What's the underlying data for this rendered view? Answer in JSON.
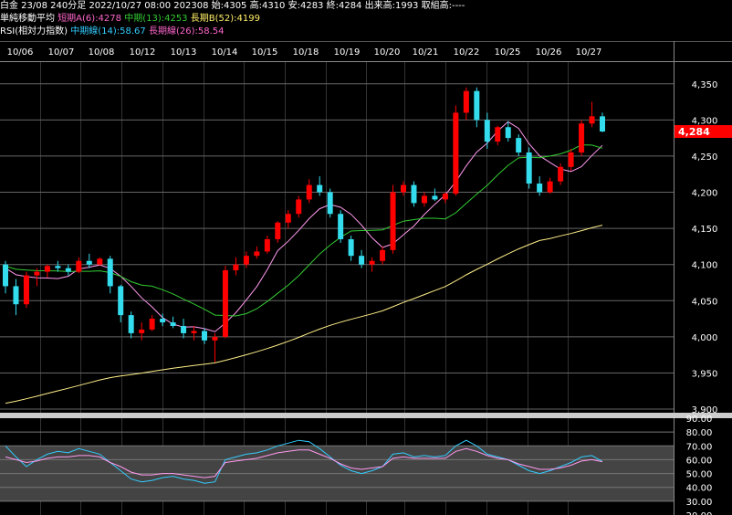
{
  "header": {
    "line1": "白金 23/08 240分足 2022/10/27 08:00 202308 始:4305 高:4310 安:4283 終:4284 出来高:1993 取組高:----",
    "ma_label": "単純移動平均",
    "ma_a": "短期A(6):4278",
    "ma_b": "中期(13):4253",
    "ma_c": "長期B(52):4199",
    "rsi_label": "RSI(相対力指数)",
    "rsi_mid": "中期線(14):58.67",
    "rsi_long": "長期線(26):58.54"
  },
  "colors": {
    "up": "#ff0000",
    "down": "#33ddee",
    "ma_short": "#ff99ee",
    "ma_mid": "#33cc33",
    "ma_long": "#ffee88",
    "rsi_mid": "#33ccff",
    "rsi_long": "#ff99ee",
    "badge": "#ff0000",
    "rsi_band": "#444444"
  },
  "chart_data": [
    {
      "type": "candlestick",
      "x_dates": [
        "10/06",
        "10/07",
        "10/08",
        "10/12",
        "10/13",
        "10/14",
        "10/15",
        "10/18",
        "10/19",
        "10/20",
        "10/21",
        "10/22",
        "10/25",
        "10/26",
        "10/27"
      ],
      "y_ticks": [
        4350,
        4300,
        4250,
        4200,
        4150,
        4100,
        4050,
        4000,
        3950,
        3900
      ],
      "y_tick_labels": [
        "4,350",
        "4,300",
        "4,250",
        "4,200",
        "4,150",
        "4,100",
        "4,050",
        "4,000",
        "3,950",
        "3,900"
      ],
      "ylim": [
        3895,
        4380
      ],
      "last_price": 4284,
      "last_price_label": "4,284",
      "candles": [
        [
          4100,
          4105,
          4060,
          4070
        ],
        [
          4070,
          4080,
          4030,
          4045
        ],
        [
          4045,
          4090,
          4040,
          4085
        ],
        [
          4085,
          4095,
          4070,
          4090
        ],
        [
          4090,
          4100,
          4082,
          4098
        ],
        [
          4098,
          4105,
          4090,
          4095
        ],
        [
          4095,
          4100,
          4085,
          4090
        ],
        [
          4090,
          4110,
          4088,
          4105
        ],
        [
          4105,
          4115,
          4095,
          4100
        ],
        [
          4100,
          4110,
          4098,
          4108
        ],
        [
          4108,
          4112,
          4060,
          4070
        ],
        [
          4070,
          4072,
          4020,
          4030
        ],
        [
          4030,
          4035,
          3998,
          4005
        ],
        [
          4005,
          4020,
          3995,
          4010
        ],
        [
          4010,
          4030,
          4008,
          4025
        ],
        [
          4025,
          4032,
          4015,
          4020
        ],
        [
          4020,
          4028,
          4012,
          4015
        ],
        [
          4015,
          4025,
          3998,
          4005
        ],
        [
          4005,
          4015,
          3995,
          4008
        ],
        [
          4008,
          4012,
          3990,
          3995
        ],
        [
          3995,
          4005,
          3965,
          4000
        ],
        [
          4000,
          4098,
          3998,
          4092
        ],
        [
          4092,
          4110,
          4085,
          4100
        ],
        [
          4100,
          4118,
          4095,
          4112
        ],
        [
          4112,
          4125,
          4108,
          4118
        ],
        [
          4118,
          4140,
          4115,
          4135
        ],
        [
          4135,
          4160,
          4130,
          4158
        ],
        [
          4158,
          4175,
          4150,
          4170
        ],
        [
          4170,
          4195,
          4165,
          4190
        ],
        [
          4190,
          4218,
          4185,
          4210
        ],
        [
          4210,
          4222,
          4195,
          4200
        ],
        [
          4200,
          4205,
          4165,
          4170
        ],
        [
          4170,
          4175,
          4130,
          4135
        ],
        [
          4135,
          4140,
          4105,
          4112
        ],
        [
          4112,
          4120,
          4095,
          4100
        ],
        [
          4100,
          4110,
          4090,
          4105
        ],
        [
          4105,
          4125,
          4100,
          4120
        ],
        [
          4120,
          4210,
          4115,
          4200
        ],
        [
          4200,
          4215,
          4195,
          4210
        ],
        [
          4210,
          4215,
          4180,
          4185
        ],
        [
          4185,
          4200,
          4180,
          4195
        ],
        [
          4195,
          4205,
          4188,
          4190
        ],
        [
          4190,
          4200,
          4185,
          4198
        ],
        [
          4198,
          4320,
          4195,
          4310
        ],
        [
          4310,
          4345,
          4300,
          4340
        ],
        [
          4340,
          4345,
          4290,
          4300
        ],
        [
          4300,
          4310,
          4260,
          4270
        ],
        [
          4270,
          4292,
          4265,
          4290
        ],
        [
          4290,
          4298,
          4270,
          4275
        ],
        [
          4275,
          4280,
          4250,
          4255
        ],
        [
          4255,
          4262,
          4205,
          4212
        ],
        [
          4212,
          4222,
          4195,
          4200
        ],
        [
          4200,
          4220,
          4198,
          4215
        ],
        [
          4215,
          4240,
          4210,
          4235
        ],
        [
          4235,
          4260,
          4230,
          4255
        ],
        [
          4255,
          4300,
          4250,
          4295
        ],
        [
          4295,
          4325,
          4290,
          4305
        ],
        [
          4305,
          4310,
          4283,
          4284
        ]
      ]
    },
    {
      "type": "line",
      "title": "RSI",
      "y_ticks": [
        90,
        80,
        70,
        60,
        50,
        40,
        30,
        20
      ],
      "y_tick_labels": [
        "90.00",
        "80.00",
        "70.00",
        "60.00",
        "50.00",
        "40.00",
        "30.00",
        "20.00"
      ],
      "ylim": [
        20,
        90
      ],
      "series": [
        {
          "name": "中期線(14)",
          "values": [
            70,
            62,
            55,
            60,
            64,
            66,
            65,
            68,
            66,
            64,
            58,
            52,
            46,
            44,
            45,
            47,
            48,
            46,
            45,
            43,
            44,
            60,
            62,
            64,
            65,
            67,
            70,
            72,
            74,
            73,
            68,
            62,
            56,
            52,
            50,
            52,
            55,
            64,
            65,
            62,
            63,
            62,
            63,
            70,
            74,
            70,
            64,
            62,
            60,
            56,
            52,
            50,
            52,
            55,
            58,
            62,
            63,
            58.67
          ]
        },
        {
          "name": "長期線(26)",
          "values": [
            62,
            60,
            58,
            59,
            61,
            62,
            62,
            63,
            63,
            62,
            58,
            55,
            51,
            49,
            49,
            50,
            50,
            49,
            48,
            47,
            48,
            58,
            59,
            60,
            61,
            63,
            65,
            66,
            67,
            67,
            64,
            61,
            57,
            54,
            53,
            54,
            55,
            61,
            62,
            61,
            61,
            61,
            61,
            66,
            68,
            66,
            63,
            61,
            60,
            57,
            55,
            53,
            53,
            54,
            56,
            59,
            60,
            58.54
          ]
        }
      ]
    }
  ]
}
